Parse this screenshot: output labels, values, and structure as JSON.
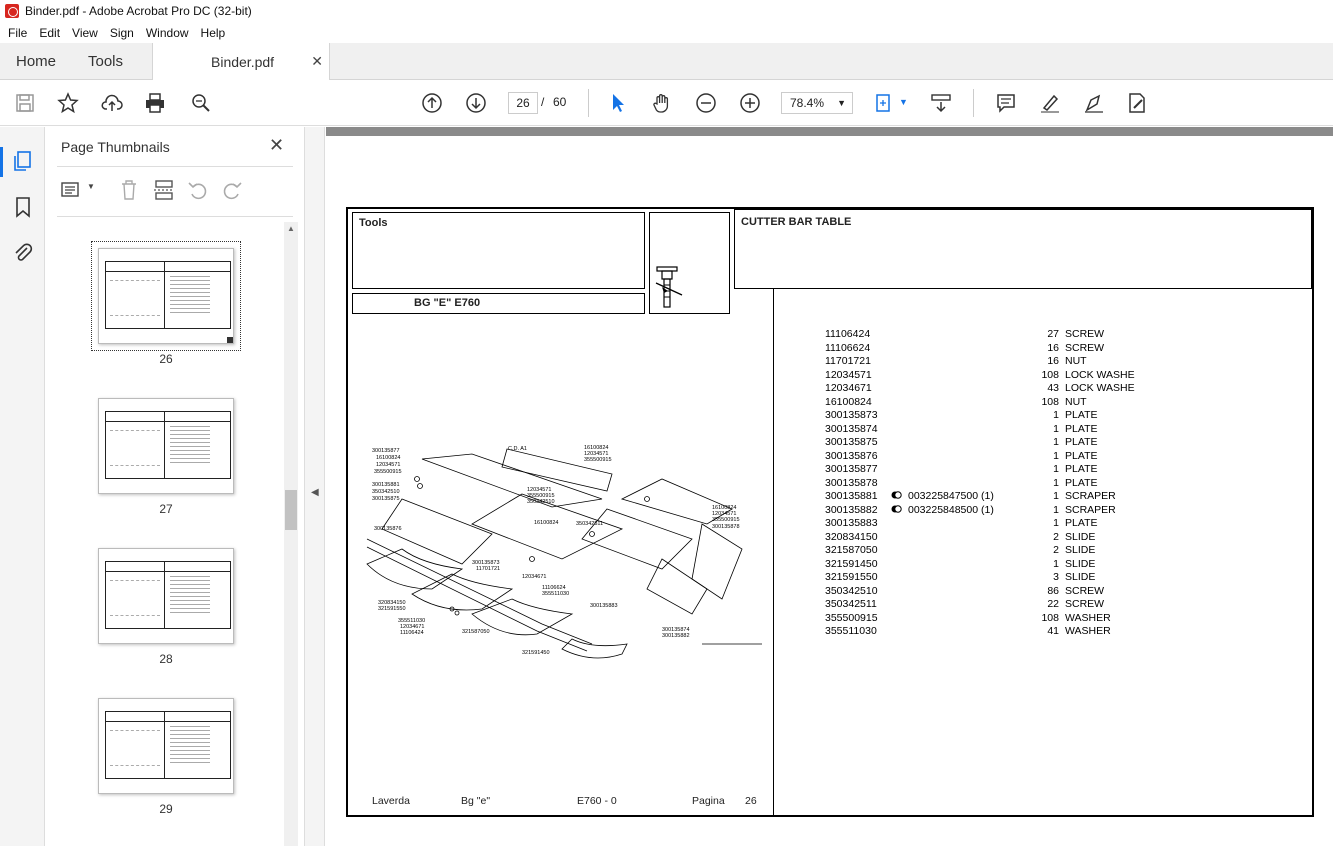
{
  "window": {
    "title": "Binder.pdf - Adobe Acrobat Pro DC (32-bit)"
  },
  "menu": [
    "File",
    "Edit",
    "View",
    "Sign",
    "Window",
    "Help"
  ],
  "tabs": {
    "home": "Home",
    "tools": "Tools",
    "document": "Binder.pdf"
  },
  "toolbar": {
    "page_current": "26",
    "page_sep": "/",
    "page_total": "60",
    "zoom": "78.4%"
  },
  "sidebar": {
    "title": "Page Thumbnails",
    "thumbnails": [
      {
        "label": "26",
        "selected": true
      },
      {
        "label": "27"
      },
      {
        "label": "28"
      },
      {
        "label": "29"
      }
    ]
  },
  "document": {
    "header_left": "Tools",
    "model": "BG \"E\"  E760",
    "header_right": "CUTTER BAR TABLE",
    "parts": [
      {
        "code": "11106424",
        "qty": "27",
        "desc": "SCREW"
      },
      {
        "code": "11106624",
        "qty": "16",
        "desc": "SCREW"
      },
      {
        "code": "11701721",
        "qty": "16",
        "desc": "NUT"
      },
      {
        "code": "12034571",
        "qty": "108",
        "desc": "LOCK WASHE"
      },
      {
        "code": "12034671",
        "qty": "43",
        "desc": "LOCK WASHE"
      },
      {
        "code": "16100824",
        "qty": "108",
        "desc": "NUT"
      },
      {
        "code": "300135873",
        "qty": "1",
        "desc": "PLATE"
      },
      {
        "code": "300135874",
        "qty": "1",
        "desc": "PLATE"
      },
      {
        "code": "300135875",
        "qty": "1",
        "desc": "PLATE"
      },
      {
        "code": "300135876",
        "qty": "1",
        "desc": "PLATE"
      },
      {
        "code": "300135877",
        "qty": "1",
        "desc": "PLATE"
      },
      {
        "code": "300135878",
        "qty": "1",
        "desc": "PLATE"
      },
      {
        "code": "300135881",
        "qty": "1",
        "desc": "SCRAPER",
        "ref": "003225847500  (1)"
      },
      {
        "code": "300135882",
        "qty": "1",
        "desc": "SCRAPER",
        "ref": "003225848500  (1)"
      },
      {
        "code": "300135883",
        "qty": "1",
        "desc": "PLATE"
      },
      {
        "code": "320834150",
        "qty": "2",
        "desc": "SLIDE"
      },
      {
        "code": "321587050",
        "qty": "2",
        "desc": "SLIDE"
      },
      {
        "code": "321591450",
        "qty": "1",
        "desc": "SLIDE"
      },
      {
        "code": "321591550",
        "qty": "3",
        "desc": "SLIDE"
      },
      {
        "code": "350342510",
        "qty": "86",
        "desc": "SCREW"
      },
      {
        "code": "350342511",
        "qty": "22",
        "desc": "SCREW"
      },
      {
        "code": "355500915",
        "qty": "108",
        "desc": "WASHER"
      },
      {
        "code": "355511030",
        "qty": "41",
        "desc": "WASHER"
      }
    ],
    "diagram_labels": {
      "l1": "300135877",
      "l2": "16100824",
      "l3": "12034571",
      "l4": "355500915",
      "l5": "300135881",
      "l6": "350342510",
      "l7": "300135875",
      "l8": "300135876",
      "l9": "C.D. A1",
      "l10": "16100824",
      "l11": "12034571",
      "l12": "355500915",
      "l13": "12034571",
      "l14": "355500915",
      "l15": "350342510",
      "l16": "16100824",
      "l17": "350342511",
      "l18": "16100824",
      "l19": "12034571",
      "l20": "355500915",
      "l21": "300135878",
      "l22": "300135873",
      "l23": "11701721",
      "l24": "12034671",
      "l25": "11106624",
      "l26": "355511030",
      "l27": "300135883",
      "l28": "320834150",
      "l29": "321591550",
      "l30": "355511030",
      "l31": "12034671",
      "l32": "11106424",
      "l33": "321587050",
      "l34": "300135874",
      "l35": "300135882",
      "l36": "321591450"
    },
    "footer": {
      "brand": "Laverda",
      "model": "Bg \"e\"",
      "code": "E760 - 0",
      "page_label": "Pagina",
      "page_no": "26"
    }
  }
}
